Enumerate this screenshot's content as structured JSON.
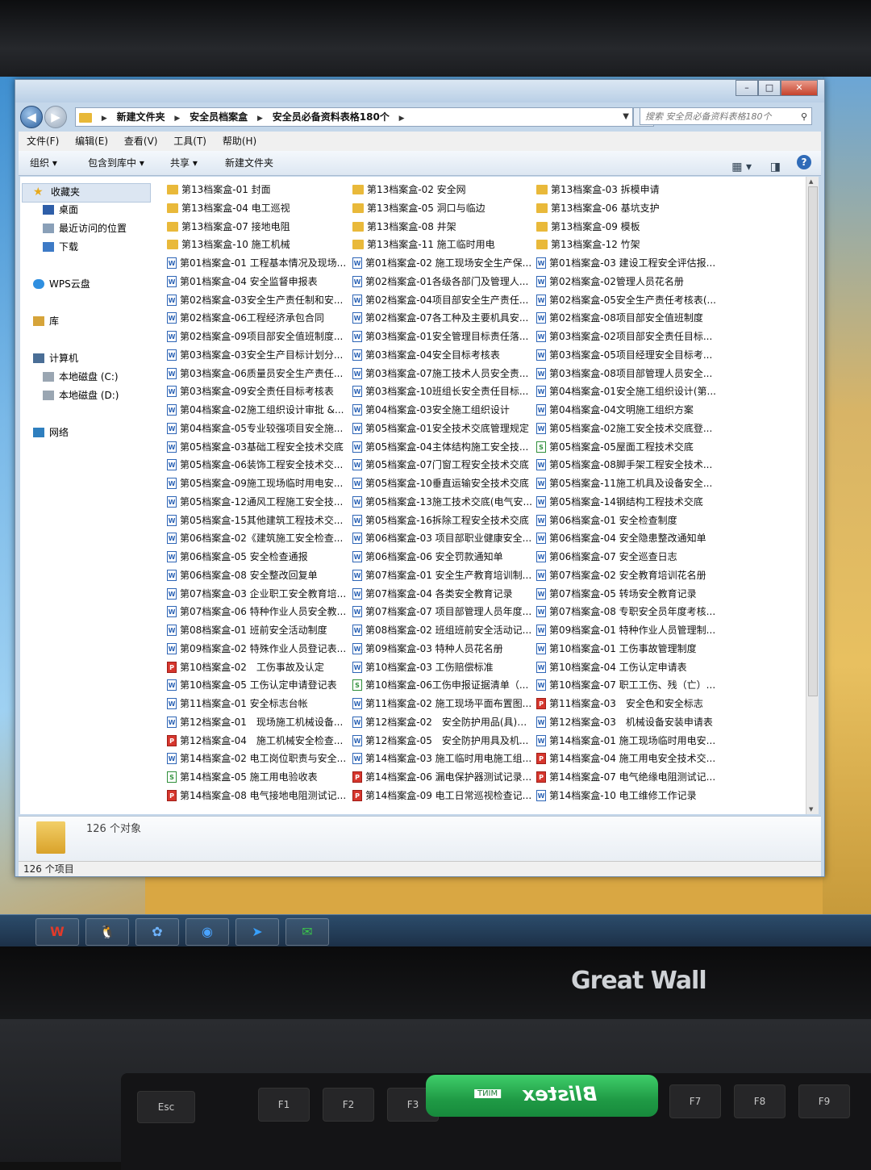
{
  "window": {
    "breadcrumb": [
      "新建文件夹",
      "安全员档案盒",
      "安全员必备资料表格180个"
    ],
    "search_placeholder": "搜索 安全员必备资料表格180个",
    "controls": {
      "min": "–",
      "max": "□",
      "close": "✕"
    }
  },
  "menu": [
    "文件(F)",
    "编辑(E)",
    "查看(V)",
    "工具(T)",
    "帮助(H)"
  ],
  "toolbar": {
    "organize": "组织 ▾",
    "include_library": "包含到库中 ▾",
    "share": "共享 ▾",
    "new_folder": "新建文件夹"
  },
  "nav": {
    "favorites": "收藏夹",
    "desktop": "桌面",
    "recent": "最近访问的位置",
    "downloads": "下载",
    "wps": "WPS云盘",
    "libraries": "库",
    "computer": "计算机",
    "drive_c": "本地磁盘 (C:)",
    "drive_d": "本地磁盘 (D:)",
    "network": "网络"
  },
  "files": [
    {
      "name": "第13档案盒-01 封面",
      "type": "folder"
    },
    {
      "name": "第13档案盒-02 安全网",
      "type": "folder"
    },
    {
      "name": "第13档案盒-03 拆模申请",
      "type": "folder"
    },
    {
      "name": "第13档案盒-04 电工巡视",
      "type": "folder"
    },
    {
      "name": "第13档案盒-05 洞口与临边",
      "type": "folder"
    },
    {
      "name": "第13档案盒-06 基坑支护",
      "type": "folder"
    },
    {
      "name": "第13档案盒-07 接地电阻",
      "type": "folder"
    },
    {
      "name": "第13档案盒-08 井架",
      "type": "folder"
    },
    {
      "name": "第13档案盒-09 模板",
      "type": "folder"
    },
    {
      "name": "第13档案盒-10 施工机械",
      "type": "folder"
    },
    {
      "name": "第13档案盒-11 施工临时用电",
      "type": "folder"
    },
    {
      "name": "第13档案盒-12 竹架",
      "type": "folder"
    },
    {
      "name": "第01档案盒-01 工程基本情况及现场...",
      "type": "doc"
    },
    {
      "name": "第01档案盒-02 施工现场安全生产保...",
      "type": "doc"
    },
    {
      "name": "第01档案盒-03 建设工程安全评估报...",
      "type": "doc"
    },
    {
      "name": "第01档案盒-04 安全监督申报表",
      "type": "doc"
    },
    {
      "name": "第02档案盒-01各级各部门及管理人...",
      "type": "doc"
    },
    {
      "name": "第02档案盒-02管理人员花名册",
      "type": "doc"
    },
    {
      "name": "第02档案盒-03安全生产责任制和安...",
      "type": "doc"
    },
    {
      "name": "第02档案盒-04项目部安全生产责任...",
      "type": "doc"
    },
    {
      "name": "第02档案盒-05安全生产责任考核表(...",
      "type": "doc"
    },
    {
      "name": "第02档案盒-06工程经济承包合同",
      "type": "doc"
    },
    {
      "name": "第02档案盒-07各工种及主要机具安...",
      "type": "doc"
    },
    {
      "name": "第02档案盒-08项目部安全值班制度",
      "type": "doc"
    },
    {
      "name": "第02档案盒-09项目部安全值班制度...",
      "type": "doc"
    },
    {
      "name": "第03档案盒-01安全管理目标责任落...",
      "type": "doc"
    },
    {
      "name": "第03档案盒-02项目部安全责任目标...",
      "type": "doc"
    },
    {
      "name": "第03档案盒-03安全生产目标计划分...",
      "type": "doc"
    },
    {
      "name": "第03档案盒-04安全目标考核表",
      "type": "doc"
    },
    {
      "name": "第03档案盒-05项目经理安全目标考...",
      "type": "doc"
    },
    {
      "name": "第03档案盒-06质量员安全生产责任...",
      "type": "doc"
    },
    {
      "name": "第03档案盒-07施工技术人员安全责...",
      "type": "doc"
    },
    {
      "name": "第03档案盒-08项目部管理人员安全...",
      "type": "doc"
    },
    {
      "name": "第03档案盒-09安全责任目标考核表",
      "type": "doc"
    },
    {
      "name": "第03档案盒-10班组长安全责任目标...",
      "type": "doc"
    },
    {
      "name": "第04档案盒-01安全施工组织设计(第...",
      "type": "doc"
    },
    {
      "name": "第04档案盒-02施工组织设计审批 &...",
      "type": "doc"
    },
    {
      "name": "第04档案盒-03安全施工组织设计",
      "type": "doc"
    },
    {
      "name": "第04档案盒-04文明施工组织方案",
      "type": "doc"
    },
    {
      "name": "第04档案盒-05专业较强项目安全施...",
      "type": "doc"
    },
    {
      "name": "第05档案盒-01安全技术交底管理规定",
      "type": "doc"
    },
    {
      "name": "第05档案盒-02施工安全技术交底登...",
      "type": "doc"
    },
    {
      "name": "第05档案盒-03基础工程安全技术交底",
      "type": "doc"
    },
    {
      "name": "第05档案盒-04主体结构施工安全技...",
      "type": "doc"
    },
    {
      "name": "第05档案盒-05屋面工程技术交底",
      "type": "xls"
    },
    {
      "name": "第05档案盒-06装饰工程安全技术交...",
      "type": "doc"
    },
    {
      "name": "第05档案盒-07门窗工程安全技术交底",
      "type": "doc"
    },
    {
      "name": "第05档案盒-08脚手架工程安全技术...",
      "type": "doc"
    },
    {
      "name": "第05档案盒-09施工现场临时用电安...",
      "type": "doc"
    },
    {
      "name": "第05档案盒-10垂直运输安全技术交底",
      "type": "doc"
    },
    {
      "name": "第05档案盒-11施工机具及设备安全...",
      "type": "doc"
    },
    {
      "name": "第05档案盒-12通风工程施工安全技...",
      "type": "doc"
    },
    {
      "name": "第05档案盒-13施工技术交底(电气安...",
      "type": "doc"
    },
    {
      "name": "第05档案盒-14钢结构工程技术交底",
      "type": "doc"
    },
    {
      "name": "第05档案盒-15其他建筑工程技术交...",
      "type": "doc"
    },
    {
      "name": "第05档案盒-16拆除工程安全技术交底",
      "type": "doc"
    },
    {
      "name": "第06档案盒-01 安全检查制度",
      "type": "doc"
    },
    {
      "name": "第06档案盒-02《建筑施工安全检查...",
      "type": "doc"
    },
    {
      "name": "第06档案盒-03 项目部职业健康安全...",
      "type": "doc"
    },
    {
      "name": "第06档案盒-04 安全隐患整改通知单",
      "type": "doc"
    },
    {
      "name": "第06档案盒-05 安全检查通报",
      "type": "doc"
    },
    {
      "name": "第06档案盒-06 安全罚款通知单",
      "type": "doc"
    },
    {
      "name": "第06档案盒-07 安全巡查日志",
      "type": "doc"
    },
    {
      "name": "第06档案盒-08 安全整改回复单",
      "type": "doc"
    },
    {
      "name": "第07档案盒-01 安全生产教育培训制...",
      "type": "doc"
    },
    {
      "name": "第07档案盒-02 安全教育培训花名册",
      "type": "doc"
    },
    {
      "name": "第07档案盒-03 企业职工安全教育培...",
      "type": "doc"
    },
    {
      "name": "第07档案盒-04 各类安全教育记录",
      "type": "doc"
    },
    {
      "name": "第07档案盒-05 转场安全教育记录",
      "type": "doc"
    },
    {
      "name": "第07档案盒-06 特种作业人员安全教...",
      "type": "doc"
    },
    {
      "name": "第07档案盒-07 项目部管理人员年度...",
      "type": "doc"
    },
    {
      "name": "第07档案盒-08 专职安全员年度考核...",
      "type": "doc"
    },
    {
      "name": "第08档案盒-01 班前安全活动制度",
      "type": "doc"
    },
    {
      "name": "第08档案盒-02 班组班前安全活动记...",
      "type": "doc"
    },
    {
      "name": "第09档案盒-01 特种作业人员管理制...",
      "type": "doc"
    },
    {
      "name": "第09档案盒-02 特殊作业人员登记表...",
      "type": "doc"
    },
    {
      "name": "第09档案盒-03 特种人员花名册",
      "type": "doc"
    },
    {
      "name": "第10档案盒-01 工伤事故管理制度",
      "type": "doc"
    },
    {
      "name": "第10档案盒-02　工伤事故及认定",
      "type": "pdf"
    },
    {
      "name": "第10档案盒-03 工伤赔偿标准",
      "type": "doc"
    },
    {
      "name": "第10档案盒-04 工伤认定申请表",
      "type": "doc"
    },
    {
      "name": "第10档案盒-05 工伤认定申请登记表",
      "type": "doc"
    },
    {
      "name": "第10档案盒-06工伤申报证据清单（...",
      "type": "xls"
    },
    {
      "name": "第10档案盒-07 职工工伤、残（亡）...",
      "type": "doc"
    },
    {
      "name": "第11档案盒-01 安全标志台帐",
      "type": "doc"
    },
    {
      "name": "第11档案盒-02 施工现场平面布置图...",
      "type": "doc"
    },
    {
      "name": "第11档案盒-03　安全色和安全标志",
      "type": "pdf"
    },
    {
      "name": "第12档案盒-01　现场施工机械设备...",
      "type": "doc"
    },
    {
      "name": "第12档案盒-02　安全防护用品(具)进...",
      "type": "doc"
    },
    {
      "name": "第12档案盒-03　机械设备安装申请表",
      "type": "doc"
    },
    {
      "name": "第12档案盒-04　施工机械安全检查...",
      "type": "pdf"
    },
    {
      "name": "第12档案盒-05　安全防护用具及机...",
      "type": "doc"
    },
    {
      "name": "第14档案盒-01 施工现场临时用电安...",
      "type": "doc"
    },
    {
      "name": "第14档案盒-02 电工岗位职责与安全...",
      "type": "doc"
    },
    {
      "name": "第14档案盒-03 施工临时用电施工组...",
      "type": "doc"
    },
    {
      "name": "第14档案盒-04 施工用电安全技术交...",
      "type": "pdf"
    },
    {
      "name": "第14档案盒-05 施工用电验收表",
      "type": "xls"
    },
    {
      "name": "第14档案盒-06 漏电保护器测试记录...",
      "type": "pdf"
    },
    {
      "name": "第14档案盒-07 电气绝缘电阻测试记...",
      "type": "pdf"
    },
    {
      "name": "第14档案盒-08 电气接地电阻测试记...",
      "type": "pdf"
    },
    {
      "name": "第14档案盒-09 电工日常巡视检查记...",
      "type": "pdf"
    },
    {
      "name": "第14档案盒-10 电工维修工作记录",
      "type": "doc"
    }
  ],
  "details": {
    "count": "126 个对象"
  },
  "status": {
    "items": "126 个项目"
  },
  "taskbar": [
    "W",
    "🐧",
    "✿",
    "◉",
    "➤",
    "✉"
  ],
  "monitor_brand": "Great Wall",
  "lip_balm": {
    "brand": "Blistex",
    "variant": "MINT"
  }
}
